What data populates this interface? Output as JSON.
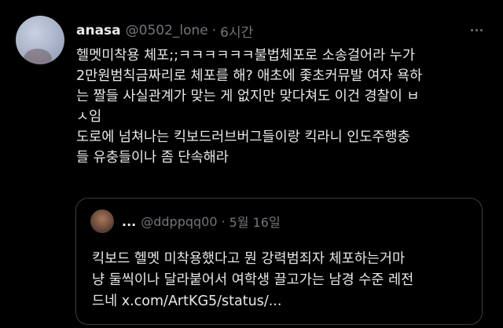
{
  "tweet": {
    "display_name": "anasa",
    "handle": "@0502_lone",
    "separator": "·",
    "time": "6시간",
    "more_icon": "more-horizontal-icon",
    "body_lines": [
      "헬멧미착용 체포;;ㅋㅋㅋㅋㅋㅋ불법체포로 소송걸어라 누가",
      "2만원범칙금짜리로 체포를 해? 애초에 좇초커뮤발 여자 욕하",
      "는 짤들 사실관계가 맞는 게 없지만 맞다쳐도 이건 경찰이 ㅂ",
      "ㅅ임",
      "도로에 넘쳐나는 킥보드러브버그들이랑 킥라니 인도주행충",
      "들 유충들이나 좀 단속해라"
    ]
  },
  "quoted": {
    "display_name": "...",
    "handle": "@ddppqq00",
    "separator": "·",
    "time": "5월 16일",
    "text_lines": [
      "킥보드 헬멧 미착용했다고 뭔 강력범죄자 체포하는거마",
      "냥 둘씩이나 달라붙어서 여학생 끌고가는 남경 수준 레전",
      "드네 x.com/ArtKG5/status/..."
    ]
  },
  "colors": {
    "background": "#000000",
    "text": "#e7e9ea",
    "secondary": "#71767b",
    "border": "#3a3d42"
  }
}
